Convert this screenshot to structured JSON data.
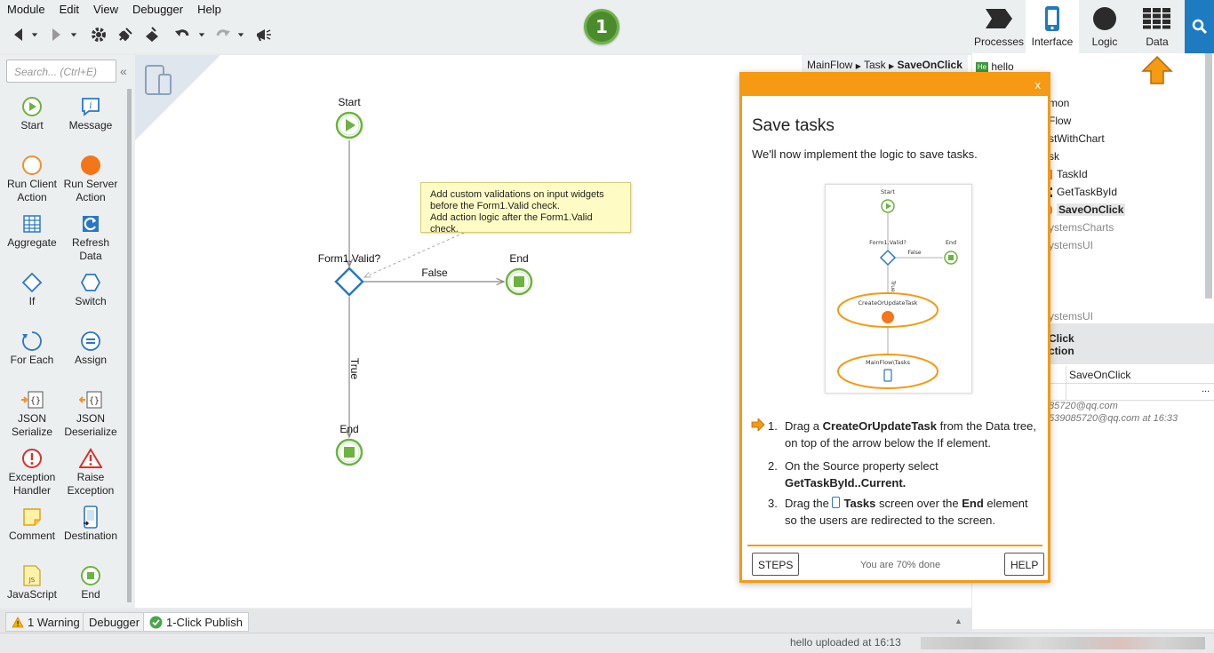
{
  "menu": [
    "Module",
    "Edit",
    "View",
    "Debugger",
    "Help"
  ],
  "publish_badge": "1",
  "right_tabs": [
    {
      "label": "Processes",
      "icon": "processes-icon"
    },
    {
      "label": "Interface",
      "icon": "phone-icon"
    },
    {
      "label": "Logic",
      "icon": "logic-icon"
    },
    {
      "label": "Data",
      "icon": "data-icon"
    }
  ],
  "toolbox": {
    "search_placeholder": "Search... (Ctrl+E)",
    "tools": [
      {
        "label": "Start",
        "icon": "start-icon"
      },
      {
        "label": "Message",
        "icon": "message-icon"
      },
      {
        "label": "Run Client Action",
        "icon": "run-client-action-icon"
      },
      {
        "label": "Run Server Action",
        "icon": "run-server-action-icon"
      },
      {
        "label": "Aggregate",
        "icon": "aggregate-icon"
      },
      {
        "label": "Refresh Data",
        "icon": "refresh-data-icon"
      },
      {
        "label": "If",
        "icon": "if-icon"
      },
      {
        "label": "Switch",
        "icon": "switch-icon"
      },
      {
        "label": "For Each",
        "icon": "for-each-icon"
      },
      {
        "label": "Assign",
        "icon": "assign-icon"
      },
      {
        "label": "JSON Serialize",
        "icon": "json-serialize-icon"
      },
      {
        "label": "JSON Deserialize",
        "icon": "json-deserialize-icon"
      },
      {
        "label": "Exception Handler",
        "icon": "exception-handler-icon"
      },
      {
        "label": "Raise Exception",
        "icon": "raise-exception-icon"
      },
      {
        "label": "Comment",
        "icon": "comment-icon"
      },
      {
        "label": "Destination",
        "icon": "destination-icon"
      },
      {
        "label": "JavaScript",
        "icon": "javascript-icon"
      },
      {
        "label": "End",
        "icon": "end-icon"
      }
    ]
  },
  "canvas": {
    "breadcrumb": {
      "part1": "MainFlow",
      "part2": "Task",
      "current": "SaveOnClick"
    },
    "start_label": "Start",
    "if_label": "Form1.Valid?",
    "false_label": "False",
    "true_label": "True",
    "end_label_right": "End",
    "end_label_bottom": "End",
    "note_lines": [
      "Add custom validations on input widgets",
      "before the Form1.Valid check.",
      "Add action logic after the Form1.Valid check."
    ]
  },
  "tree": {
    "root": "hello",
    "items": [
      "mon",
      "Flow",
      "stWithChart",
      "sk",
      "TaskId",
      "GetTaskById",
      "SaveOnClick",
      "ystemsCharts",
      "ystemsUI",
      "ystemsUI"
    ],
    "props_title": "Click",
    "props_subtitle": "ction",
    "props_name_value": "SaveOnClick",
    "props_ellipsis": "...",
    "meta_line1": "85720@qq.com",
    "meta_line2": "539085720@qq.com at 16:33"
  },
  "tutorial": {
    "close": "x",
    "title": "Save tasks",
    "subtitle": "We'll now implement the logic to save tasks.",
    "image": {
      "start": "Start",
      "if": "Form1.Valid?",
      "false": "False",
      "end": "End",
      "true": "True",
      "node1": "CreateOrUpdateTask",
      "node2": "MainFlow\\Tasks"
    },
    "steps": [
      {
        "num": "1.",
        "pre": "Drag a ",
        "bold1": "CreateOrUpdateTask",
        "mid": " from the Data tree, on top of the arrow below the If element."
      },
      {
        "num": "2.",
        "pre": "On the Source property select ",
        "bold1": "GetTaskById..Current."
      },
      {
        "num": "3.",
        "pre": "Drag the ",
        "bold1": "Tasks",
        "mid": " screen over the ",
        "bold2": "End",
        "post": " element so the users are redirected to the screen."
      }
    ],
    "steps_button": "STEPS",
    "help_button": "HELP",
    "progress": "You are 70% done"
  },
  "bottom_tabs": {
    "warning": "1 Warning",
    "debugger": "Debugger",
    "publish": "1-Click Publish"
  },
  "status": "hello uploaded at 16:13",
  "colors": {
    "accent_orange": "#f59a12",
    "flow_green": "#6db33f",
    "if_blue": "#2a78c4",
    "brand_blue": "#1e7bbf"
  }
}
